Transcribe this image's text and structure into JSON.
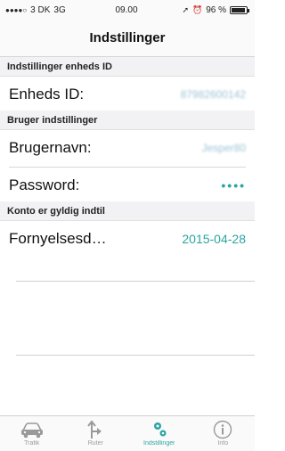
{
  "status_bar": {
    "carrier": "3 DK",
    "network": "3G",
    "time": "09.00",
    "battery_text": "96 %",
    "battery_level": 0.96
  },
  "nav": {
    "title": "Indstillinger"
  },
  "sections": {
    "device": {
      "header": "Indstillinger enheds ID"
    },
    "user": {
      "header": "Bruger indstillinger"
    },
    "account": {
      "header": "Konto er gyldig indtil"
    }
  },
  "rows": {
    "device_id": {
      "label": "Enheds ID:",
      "value": "87982600142"
    },
    "username": {
      "label": "Brugernavn:",
      "value": "Jesper80"
    },
    "password": {
      "label": "Password:",
      "value": "••••"
    },
    "renewal": {
      "label": "Fornyelsesd…",
      "value": "2015-04-28"
    }
  },
  "tabs": [
    {
      "icon": "car-icon",
      "label": "Trafik"
    },
    {
      "icon": "route-icon",
      "label": "Ruter"
    },
    {
      "icon": "gears-icon",
      "label": "Indstillinger"
    },
    {
      "icon": "info-icon",
      "label": "Info"
    }
  ],
  "colors": {
    "accent": "#2aa5a0",
    "inactive": "#9a9a9a"
  }
}
